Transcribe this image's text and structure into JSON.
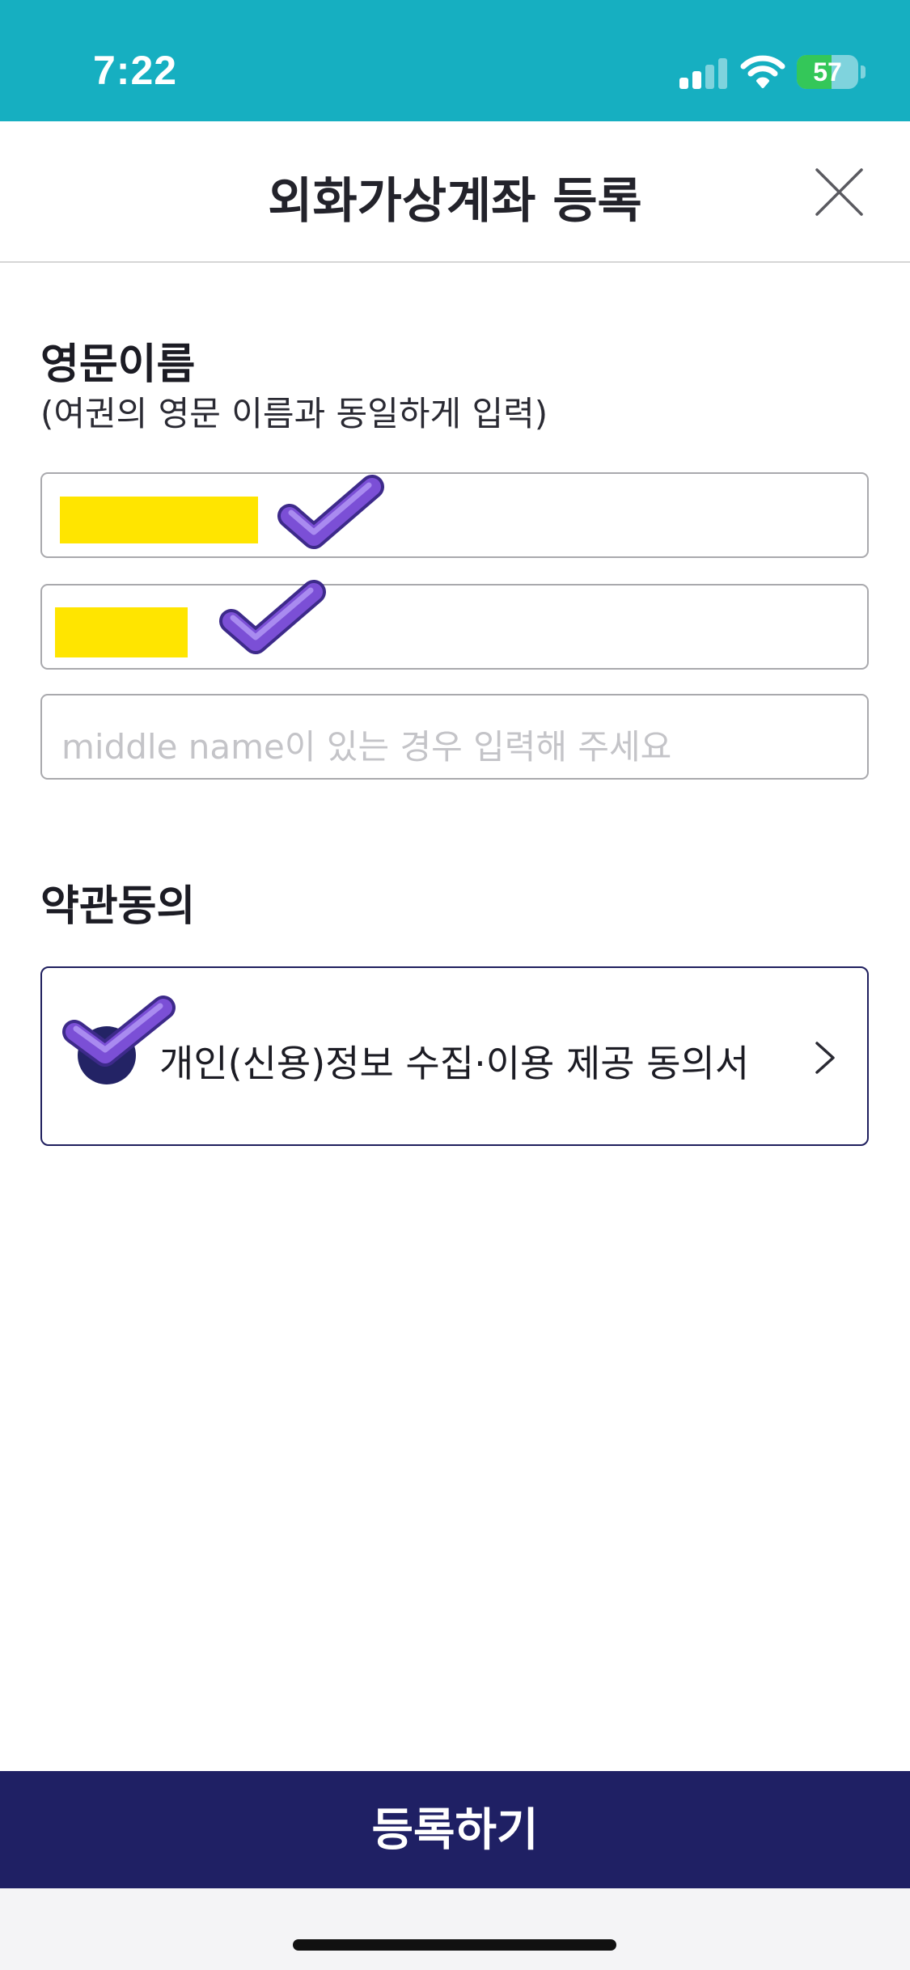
{
  "status_bar": {
    "time": "7:22",
    "battery_level": "57",
    "battery_fraction": 0.57,
    "signal_icon": "cellular-signal-icon",
    "wifi_icon": "wifi-icon",
    "battery_icon": "battery-charging-icon"
  },
  "header": {
    "title": "외화가상계좌 등록",
    "close_icon": "close-icon"
  },
  "name_section": {
    "title": "영문이름",
    "subtitle": "(여권의 영문 이름과 동일하게 입력)",
    "last_name_value": "",
    "first_name_value": "",
    "middle_name_placeholder": "middle name이 있는 경우 입력해 주세요"
  },
  "terms_section": {
    "title": "약관동의",
    "agreement_label": "개인(신용)정보 수집·이용 제공 동의서",
    "agreement_checked": true,
    "chevron_icon": "chevron-right-icon"
  },
  "footer": {
    "submit_label": "등록하기"
  },
  "colors": {
    "status_bar_bg": "#16afc1",
    "primary_navy": "#1f2064",
    "redaction_yellow": "#ffe500",
    "checkmark_purple": "#7b4fd6",
    "battery_green": "#34c759"
  }
}
